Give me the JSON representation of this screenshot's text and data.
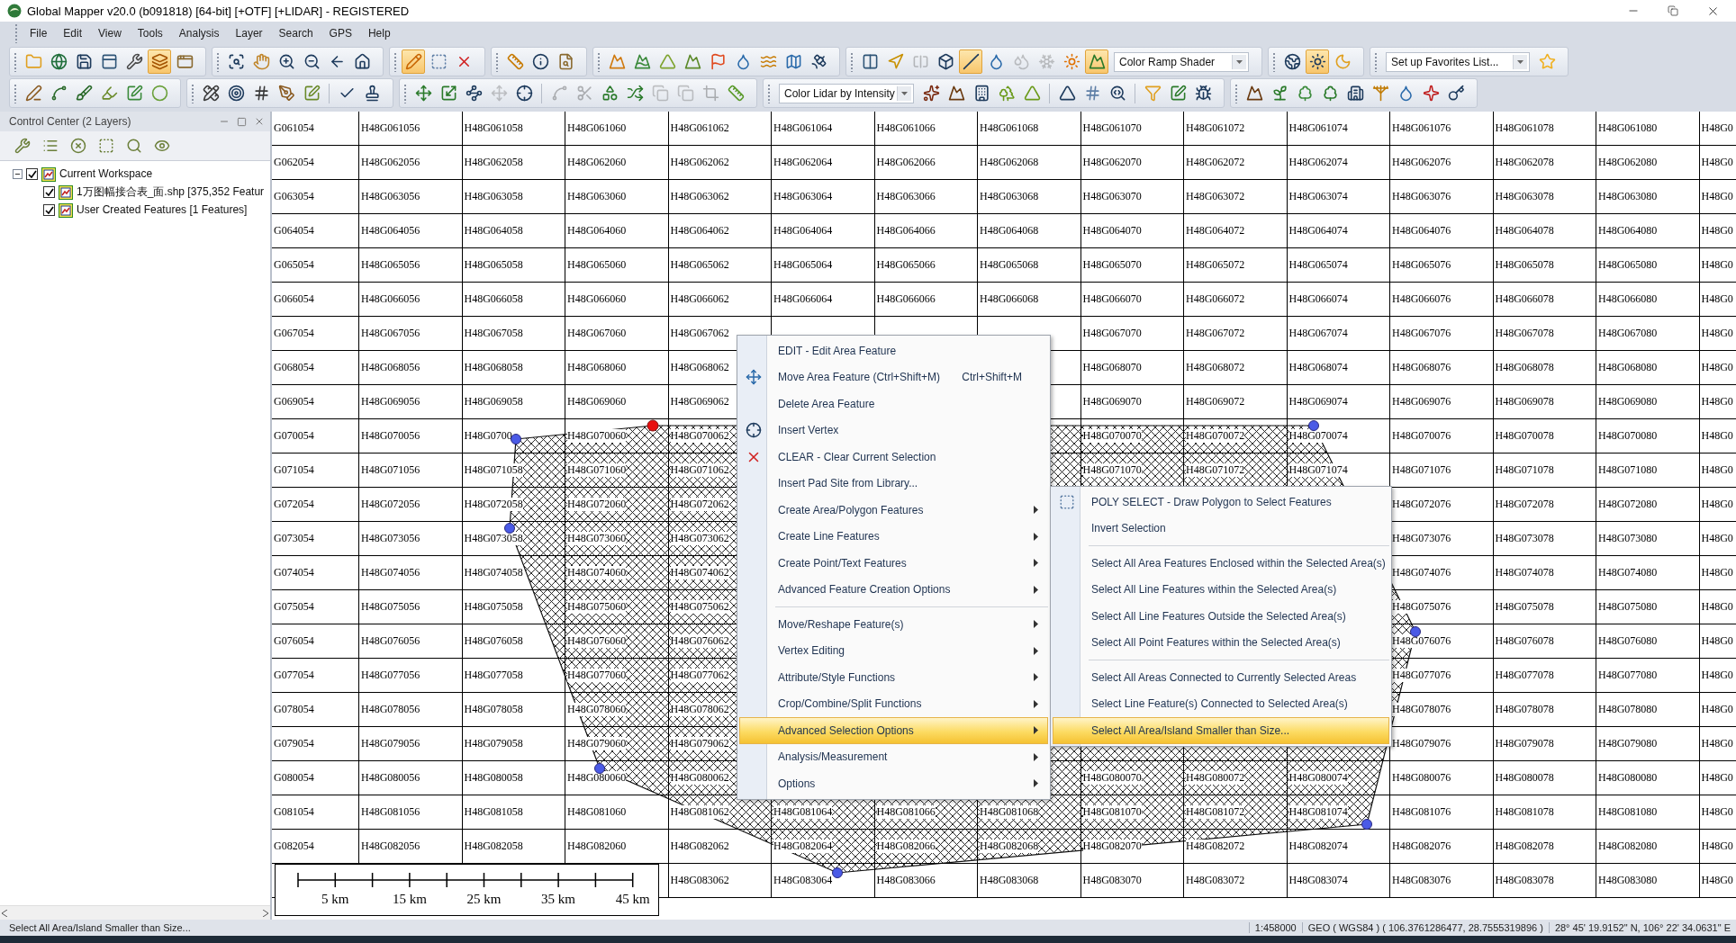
{
  "window": {
    "title": "Global Mapper v20.0 (b091818) [64-bit] [+OTF] [+LIDAR] - REGISTERED"
  },
  "menu_bar": [
    "File",
    "Edit",
    "View",
    "Tools",
    "Analysis",
    "Layer",
    "Search",
    "GPS",
    "Help"
  ],
  "toolbars": [
    [
      {
        "items": [
          {
            "kind": "button",
            "selected": false,
            "disabled": false
          },
          {
            "kind": "button",
            "selected": false,
            "disabled": false
          },
          {
            "kind": "button",
            "selected": false,
            "disabled": false
          },
          {
            "kind": "button",
            "selected": false,
            "disabled": false
          },
          {
            "kind": "button",
            "selected": false,
            "disabled": false
          },
          {
            "kind": "button",
            "selected": true,
            "disabled": false
          },
          {
            "kind": "button",
            "selected": false,
            "disabled": false
          }
        ]
      },
      {
        "items": [
          {
            "kind": "button",
            "selected": false,
            "disabled": false
          },
          {
            "kind": "button",
            "selected": false,
            "disabled": false
          },
          {
            "kind": "button",
            "selected": false,
            "disabled": false
          },
          {
            "kind": "button",
            "selected": false,
            "disabled": false
          },
          {
            "kind": "button",
            "selected": false,
            "disabled": false
          },
          {
            "kind": "button",
            "selected": false,
            "disabled": false
          }
        ]
      },
      {
        "items": [
          {
            "kind": "button",
            "selected": true,
            "disabled": false
          },
          {
            "kind": "button",
            "selected": false,
            "disabled": false
          },
          {
            "kind": "button",
            "selected": false,
            "disabled": false
          }
        ]
      },
      {
        "items": [
          {
            "kind": "button",
            "selected": false,
            "disabled": false
          },
          {
            "kind": "button",
            "selected": false,
            "disabled": false
          },
          {
            "kind": "button",
            "selected": false,
            "disabled": false
          }
        ]
      },
      {
        "items": [
          {
            "kind": "button",
            "selected": false,
            "disabled": false
          },
          {
            "kind": "button",
            "selected": false,
            "disabled": false
          },
          {
            "kind": "button",
            "selected": false,
            "disabled": false
          },
          {
            "kind": "button",
            "selected": false,
            "disabled": false
          },
          {
            "kind": "button",
            "selected": false,
            "disabled": false
          },
          {
            "kind": "button",
            "selected": false,
            "disabled": false
          },
          {
            "kind": "button",
            "selected": false,
            "disabled": false
          },
          {
            "kind": "button",
            "selected": false,
            "disabled": false
          },
          {
            "kind": "button",
            "selected": false,
            "disabled": false
          }
        ]
      },
      {
        "items": [
          {
            "kind": "button",
            "selected": false,
            "disabled": false
          },
          {
            "kind": "button",
            "selected": false,
            "disabled": false
          },
          {
            "kind": "button",
            "selected": false,
            "disabled": true
          },
          {
            "kind": "button",
            "selected": false,
            "disabled": false
          },
          {
            "kind": "button",
            "selected": true,
            "disabled": false
          },
          {
            "kind": "button",
            "selected": false,
            "disabled": false
          },
          {
            "kind": "button",
            "selected": false,
            "disabled": true
          },
          {
            "kind": "button",
            "selected": false,
            "disabled": true
          },
          {
            "kind": "button",
            "selected": false,
            "disabled": false
          },
          {
            "kind": "button",
            "selected": true,
            "disabled": false
          },
          {
            "kind": "dropdown",
            "value": "Color Ramp Shader"
          }
        ]
      },
      {
        "items": [
          {
            "kind": "button",
            "selected": false,
            "disabled": false
          },
          {
            "kind": "button",
            "selected": true,
            "disabled": false
          },
          {
            "kind": "button",
            "selected": false,
            "disabled": false
          }
        ]
      },
      {
        "items": [
          {
            "kind": "dropdown",
            "value": "Set up Favorites List..."
          },
          {
            "kind": "button",
            "selected": false,
            "disabled": false
          }
        ]
      }
    ],
    [
      {
        "items": [
          {
            "kind": "button",
            "selected": false,
            "disabled": false
          },
          {
            "kind": "button",
            "selected": false,
            "disabled": false
          },
          {
            "kind": "button",
            "selected": false,
            "disabled": false
          },
          {
            "kind": "button",
            "selected": false,
            "disabled": false
          },
          {
            "kind": "button",
            "selected": false,
            "disabled": false
          },
          {
            "kind": "button",
            "selected": false,
            "disabled": false
          }
        ]
      },
      {
        "items": [
          {
            "kind": "button",
            "selected": false,
            "disabled": false
          },
          {
            "kind": "button",
            "selected": false,
            "disabled": false
          },
          {
            "kind": "button",
            "selected": false,
            "disabled": false
          },
          {
            "kind": "button",
            "selected": false,
            "disabled": false
          },
          {
            "kind": "button",
            "selected": false,
            "disabled": false
          },
          {
            "kind": "separator"
          },
          {
            "kind": "button",
            "selected": false,
            "disabled": false
          },
          {
            "kind": "button",
            "selected": false,
            "disabled": false
          }
        ]
      },
      {
        "items": [
          {
            "kind": "button",
            "selected": false,
            "disabled": false
          },
          {
            "kind": "button",
            "selected": false,
            "disabled": false
          },
          {
            "kind": "button",
            "selected": false,
            "disabled": false
          },
          {
            "kind": "button",
            "selected": false,
            "disabled": true
          },
          {
            "kind": "button",
            "selected": false,
            "disabled": false
          },
          {
            "kind": "separator"
          },
          {
            "kind": "button",
            "selected": false,
            "disabled": true
          },
          {
            "kind": "button",
            "selected": false,
            "disabled": true
          },
          {
            "kind": "button",
            "selected": false,
            "disabled": false
          },
          {
            "kind": "button",
            "selected": false,
            "disabled": false
          },
          {
            "kind": "button",
            "selected": false,
            "disabled": true
          },
          {
            "kind": "button",
            "selected": false,
            "disabled": true
          },
          {
            "kind": "button",
            "selected": false,
            "disabled": true
          },
          {
            "kind": "button",
            "selected": false,
            "disabled": false
          }
        ]
      },
      {
        "items": [
          {
            "kind": "dropdown",
            "value": "Color Lidar by Intensity"
          },
          {
            "kind": "button",
            "selected": false,
            "disabled": false
          },
          {
            "kind": "button",
            "selected": false,
            "disabled": false
          },
          {
            "kind": "button",
            "selected": false,
            "disabled": false
          },
          {
            "kind": "button",
            "selected": false,
            "disabled": false
          },
          {
            "kind": "button",
            "selected": false,
            "disabled": false
          },
          {
            "kind": "separator"
          },
          {
            "kind": "button",
            "selected": false,
            "disabled": false
          },
          {
            "kind": "button",
            "selected": false,
            "disabled": false
          },
          {
            "kind": "button",
            "selected": false,
            "disabled": false
          },
          {
            "kind": "separator"
          },
          {
            "kind": "button",
            "selected": false,
            "disabled": false
          },
          {
            "kind": "button",
            "selected": false,
            "disabled": false
          },
          {
            "kind": "button",
            "selected": false,
            "disabled": false
          }
        ]
      },
      {
        "items": [
          {
            "kind": "button",
            "selected": false,
            "disabled": false
          },
          {
            "kind": "button",
            "selected": false,
            "disabled": false
          },
          {
            "kind": "button",
            "selected": false,
            "disabled": false
          },
          {
            "kind": "button",
            "selected": false,
            "disabled": false
          },
          {
            "kind": "button",
            "selected": false,
            "disabled": false
          },
          {
            "kind": "button",
            "selected": false,
            "disabled": false
          },
          {
            "kind": "button",
            "selected": false,
            "disabled": false
          },
          {
            "kind": "button",
            "selected": false,
            "disabled": false
          },
          {
            "kind": "button",
            "selected": false,
            "disabled": false
          }
        ]
      }
    ]
  ],
  "control_center": {
    "title": "Control Center (2 Layers)",
    "tree": [
      {
        "label": "Current Workspace",
        "checked": true,
        "expanded": true,
        "children": [
          {
            "label": "1万图幅接合表_面.shp [375,352 Featur",
            "checked": true
          },
          {
            "label": "User Created Features [1 Features]",
            "checked": true
          }
        ]
      }
    ]
  },
  "map": {
    "rows": [
      [
        "G061054",
        "H48G061056",
        "H48G061058",
        "H48G061060",
        "H48G061062",
        "H48G061064",
        "H48G061066",
        "H48G061068",
        "H48G061070",
        "H48G061072",
        "H48G061074",
        "H48G061076",
        "H48G061078",
        "H48G061080",
        "H48G0"
      ],
      [
        "G062054",
        "H48G062056",
        "H48G062058",
        "H48G062060",
        "H48G062062",
        "H48G062064",
        "H48G062066",
        "H48G062068",
        "H48G062070",
        "H48G062072",
        "H48G062074",
        "H48G062076",
        "H48G062078",
        "H48G062080",
        "H48G0"
      ],
      [
        "G063054",
        "H48G063056",
        "H48G063058",
        "H48G063060",
        "H48G063062",
        "H48G063064",
        "H48G063066",
        "H48G063068",
        "H48G063070",
        "H48G063072",
        "H48G063074",
        "H48G063076",
        "H48G063078",
        "H48G063080",
        "H48G0"
      ],
      [
        "G064054",
        "H48G064056",
        "H48G064058",
        "H48G064060",
        "H48G064062",
        "H48G064064",
        "H48G064066",
        "H48G064068",
        "H48G064070",
        "H48G064072",
        "H48G064074",
        "H48G064076",
        "H48G064078",
        "H48G064080",
        "H48G0"
      ],
      [
        "G065054",
        "H48G065056",
        "H48G065058",
        "H48G065060",
        "H48G065062",
        "H48G065064",
        "H48G065066",
        "H48G065068",
        "H48G065070",
        "H48G065072",
        "H48G065074",
        "H48G065076",
        "H48G065078",
        "H48G065080",
        "H48G0"
      ],
      [
        "G066054",
        "H48G066056",
        "H48G066058",
        "H48G066060",
        "H48G066062",
        "H48G066064",
        "H48G066066",
        "H48G066068",
        "H48G066070",
        "H48G066072",
        "H48G066074",
        "H48G066076",
        "H48G066078",
        "H48G066080",
        "H48G0"
      ],
      [
        "G067054",
        "H48G067056",
        "H48G067058",
        "H48G067060",
        "H48G067062",
        null,
        null,
        null,
        "H48G067070",
        "H48G067072",
        "H48G067074",
        "H48G067076",
        "H48G067078",
        "H48G067080",
        "H48G0"
      ],
      [
        "G068054",
        "H48G068056",
        "H48G068058",
        "H48G068060",
        "H48G068062",
        null,
        null,
        null,
        "H48G068070",
        "H48G068072",
        "H48G068074",
        "H48G068076",
        "H48G068078",
        "H48G068080",
        "H48G0"
      ],
      [
        "G069054",
        "H48G069056",
        "H48G069058",
        "H48G069060",
        "H48G069062",
        null,
        null,
        null,
        "H48G069070",
        "H48G069072",
        "H48G069074",
        "H48G069076",
        "H48G069078",
        "H48G069080",
        "H48G0"
      ],
      [
        "G070054",
        "H48G070056",
        "H48G0700",
        "H48G070060",
        "H48G070062",
        null,
        null,
        null,
        "H48G070070",
        "H48G070072",
        "H48G070074",
        "H48G070076",
        "H48G070078",
        "H48G070080",
        "H48G0"
      ],
      [
        "G071054",
        "H48G071056",
        "H48G071058",
        "H48G071060",
        "H48G071062",
        null,
        null,
        null,
        "H48G071070",
        "H48G071072",
        "H48G071074",
        "H48G071076",
        "H48G071078",
        "H48G071080",
        "H48G0"
      ],
      [
        "G072054",
        "H48G072056",
        "H48G072058",
        "H48G072060",
        "H48G072062",
        null,
        null,
        null,
        null,
        null,
        null,
        "H48G072076",
        "H48G072078",
        "H48G072080",
        "H48G0"
      ],
      [
        "G073054",
        "H48G073056",
        "H48G073058",
        "H48G073060",
        "H48G073062",
        null,
        null,
        null,
        null,
        null,
        null,
        "H48G073076",
        "H48G073078",
        "H48G073080",
        "H48G0"
      ],
      [
        "G074054",
        "H48G074056",
        "H48G074058",
        "H48G074060",
        "H48G074062",
        null,
        null,
        null,
        null,
        null,
        null,
        "H48G074076",
        "H48G074078",
        "H48G074080",
        "H48G0"
      ],
      [
        "G075054",
        "H48G075056",
        "H48G075058",
        "H48G075060",
        "H48G075062",
        null,
        null,
        null,
        null,
        null,
        null,
        "H48G075076",
        "H48G075078",
        "H48G075080",
        "H48G0"
      ],
      [
        "G076054",
        "H48G076056",
        "H48G076058",
        "H48G076060",
        "H48G076062",
        null,
        null,
        null,
        null,
        null,
        null,
        "H48G076076",
        "H48G076078",
        "H48G076080",
        "H48G0"
      ],
      [
        "G077054",
        "H48G077056",
        "H48G077058",
        "H48G077060",
        "H48G077062",
        null,
        null,
        null,
        null,
        null,
        null,
        "H48G077076",
        "H48G077078",
        "H48G077080",
        "H48G0"
      ],
      [
        "G078054",
        "H48G078056",
        "H48G078058",
        "H48G078060",
        "H48G078062",
        null,
        null,
        null,
        null,
        null,
        null,
        "H48G078076",
        "H48G078078",
        "H48G078080",
        "H48G0"
      ],
      [
        "G079054",
        "H48G079056",
        "H48G079058",
        "H48G079060",
        "H48G079062",
        null,
        null,
        null,
        null,
        null,
        null,
        "H48G079076",
        "H48G079078",
        "H48G079080",
        "H48G0"
      ],
      [
        "G080054",
        "H48G080056",
        "H48G080058",
        "H48G080060",
        "H48G080062",
        null,
        null,
        null,
        "H48G080070",
        "H48G080072",
        "H48G080074",
        "H48G080076",
        "H48G080078",
        "H48G080080",
        "H48G0"
      ],
      [
        "G081054",
        "H48G081056",
        "H48G081058",
        "H48G081060",
        "H48G081062",
        "H48G081064",
        "H48G081066",
        "H48G081068",
        "H48G081070",
        "H48G081072",
        "H48G081074",
        "H48G081076",
        "H48G081078",
        "H48G081080",
        "H48G0"
      ],
      [
        "G082054",
        "H48G082056",
        "H48G082058",
        "H48G082060",
        "H48G082062",
        "H48G082064",
        "H48G082066",
        "H48G082068",
        "H48G082070",
        "H48G082072",
        "H48G082074",
        "H48G082076",
        "H48G082078",
        "H48G082080",
        "H48G0"
      ],
      [
        null,
        null,
        null,
        null,
        "H48G083062",
        "H48G083064",
        "H48G083066",
        "H48G083068",
        "H48G083070",
        "H48G083072",
        "H48G083074",
        "H48G083076",
        "H48G083078",
        "H48G083080",
        "H48G0"
      ]
    ],
    "scale_bar": {
      "labels": [
        "5 km",
        "15 km",
        "25 km",
        "35 km",
        "45 km"
      ]
    }
  },
  "context_menu": [
    {
      "kind": "item",
      "label": "EDIT - Edit Area Feature",
      "selected": false
    },
    {
      "kind": "item",
      "label": "Move Area Feature (Ctrl+Shift+M)",
      "shortcut": "Ctrl+Shift+M",
      "selected": false
    },
    {
      "kind": "item",
      "label": "Delete Area Feature",
      "selected": false
    },
    {
      "kind": "item",
      "label": "Insert Vertex",
      "selected": false
    },
    {
      "kind": "item",
      "label": "CLEAR - Clear Current Selection",
      "selected": false
    },
    {
      "kind": "item",
      "label": "Insert Pad Site from Library...",
      "selected": false
    },
    {
      "kind": "submenu",
      "label": "Create Area/Polygon Features",
      "selected": false
    },
    {
      "kind": "submenu",
      "label": "Create Line Features",
      "selected": false
    },
    {
      "kind": "submenu",
      "label": "Create Point/Text Features",
      "selected": false
    },
    {
      "kind": "submenu",
      "label": "Advanced Feature Creation Options",
      "selected": false
    },
    {
      "kind": "separator"
    },
    {
      "kind": "submenu",
      "label": "Move/Reshape Feature(s)",
      "selected": false
    },
    {
      "kind": "submenu",
      "label": "Vertex Editing",
      "selected": false
    },
    {
      "kind": "submenu",
      "label": "Attribute/Style Functions",
      "selected": false
    },
    {
      "kind": "submenu",
      "label": "Crop/Combine/Split Functions",
      "selected": false
    },
    {
      "kind": "submenu",
      "label": "Advanced Selection Options",
      "selected": true
    },
    {
      "kind": "submenu",
      "label": "Analysis/Measurement",
      "selected": false
    },
    {
      "kind": "submenu",
      "label": "Options",
      "selected": false
    }
  ],
  "submenu": [
    {
      "kind": "item",
      "label": "POLY SELECT - Draw Polygon to Select Features",
      "selected": false
    },
    {
      "kind": "item",
      "label": "Invert Selection",
      "selected": false
    },
    {
      "kind": "separator"
    },
    {
      "kind": "item",
      "label": "Select All Area Features Enclosed within the Selected Area(s)",
      "selected": false
    },
    {
      "kind": "item",
      "label": "Select All Line Features within the Selected Area(s)",
      "selected": false
    },
    {
      "kind": "item",
      "label": "Select All Line Features Outside the Selected Area(s)",
      "selected": false
    },
    {
      "kind": "item",
      "label": "Select All Point Features within the Selected Area(s)",
      "selected": false
    },
    {
      "kind": "separator"
    },
    {
      "kind": "item",
      "label": "Select All Areas Connected to Currently Selected Areas",
      "selected": false
    },
    {
      "kind": "item",
      "label": "Select Line Feature(s) Connected to Selected Area(s)",
      "selected": false
    },
    {
      "kind": "item",
      "label": "Select All Area/Island Smaller than Size...",
      "selected": true
    }
  ],
  "status_bar": {
    "message": "Select All Area/Island Smaller than Size...",
    "scale": "1:458000",
    "projection": "GEO ( WGS84 ) ( 106.3761286477, 28.7555319896 )",
    "position": "28° 45' 19.9152\" N, 106° 22' 34.0631\" E"
  }
}
